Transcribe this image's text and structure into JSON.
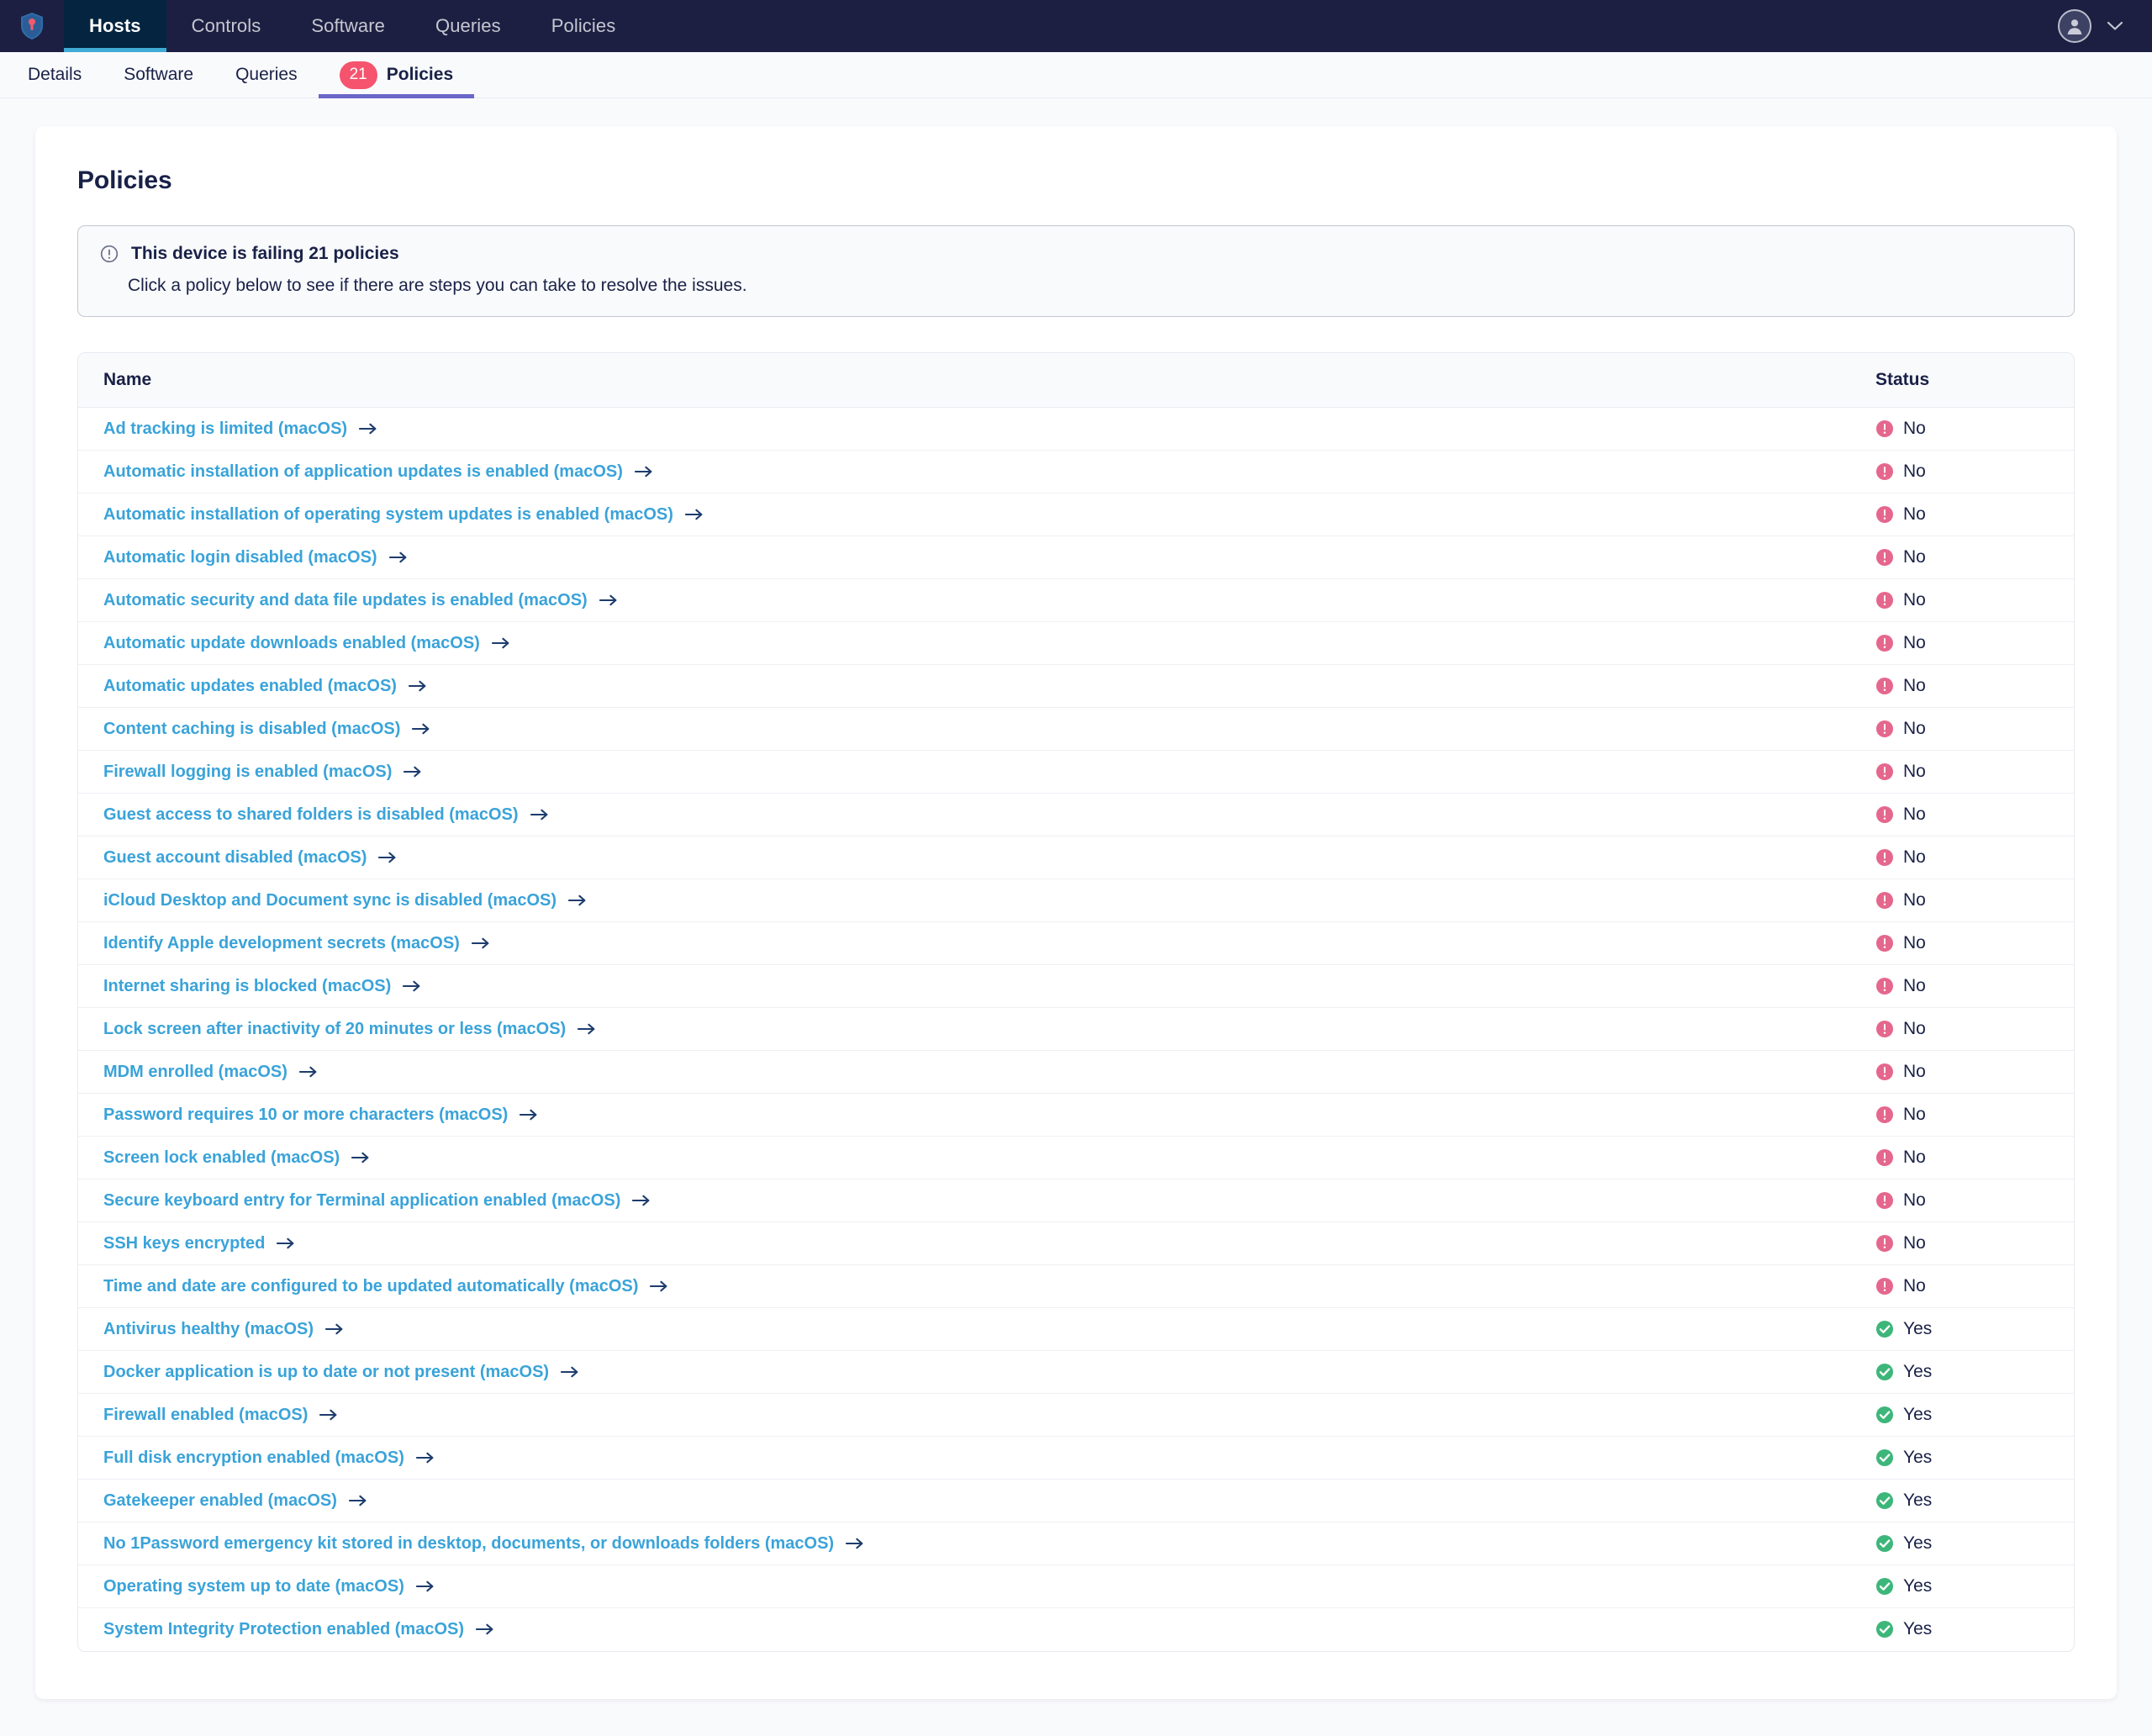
{
  "colors": {
    "nav_bg": "#1d1f42",
    "nav_active_bg": "#04243f",
    "nav_accent": "#3eabd5",
    "badge": "#f5536e",
    "subnav_active_underline": "#6a67c8",
    "link": "#3aa3d9",
    "arrow": "#1d3c6e",
    "fail": "#e5678e",
    "pass": "#3db67a",
    "text": "#192147",
    "page_bg": "#f9fafc"
  },
  "topnav": {
    "logo_icon": "shield-icon",
    "items": [
      {
        "label": "Hosts",
        "active": true
      },
      {
        "label": "Controls",
        "active": false
      },
      {
        "label": "Software",
        "active": false
      },
      {
        "label": "Queries",
        "active": false
      },
      {
        "label": "Policies",
        "active": false
      }
    ],
    "avatar_icon": "user-avatar-icon",
    "chevron_icon": "chevron-down-icon"
  },
  "subnav": {
    "items": [
      {
        "label": "Details",
        "badge": null,
        "active": false
      },
      {
        "label": "Software",
        "badge": null,
        "active": false
      },
      {
        "label": "Queries",
        "badge": null,
        "active": false
      },
      {
        "label": "Policies",
        "badge": "21",
        "active": true
      }
    ]
  },
  "main": {
    "title": "Policies",
    "banner": {
      "icon": "alert-circle-icon",
      "title": "This device is failing 21 policies",
      "subtitle": "Click a policy below to see if there are steps you can take to resolve the issues."
    },
    "table": {
      "columns": [
        "Name",
        "Status"
      ],
      "fail_icon": "exclamation-circle-icon",
      "pass_icon": "check-circle-icon",
      "arrow_icon": "arrow-right-icon",
      "rows": [
        {
          "name": "Ad tracking is limited (macOS)",
          "status": "No",
          "pass": false
        },
        {
          "name": "Automatic installation of application updates is enabled (macOS)",
          "status": "No",
          "pass": false
        },
        {
          "name": "Automatic installation of operating system updates is enabled (macOS)",
          "status": "No",
          "pass": false
        },
        {
          "name": "Automatic login disabled (macOS)",
          "status": "No",
          "pass": false
        },
        {
          "name": "Automatic security and data file updates is enabled (macOS)",
          "status": "No",
          "pass": false
        },
        {
          "name": "Automatic update downloads enabled (macOS)",
          "status": "No",
          "pass": false
        },
        {
          "name": "Automatic updates enabled (macOS)",
          "status": "No",
          "pass": false
        },
        {
          "name": "Content caching is disabled (macOS)",
          "status": "No",
          "pass": false
        },
        {
          "name": "Firewall logging is enabled (macOS)",
          "status": "No",
          "pass": false
        },
        {
          "name": "Guest access to shared folders is disabled (macOS)",
          "status": "No",
          "pass": false
        },
        {
          "name": "Guest account disabled (macOS)",
          "status": "No",
          "pass": false
        },
        {
          "name": "iCloud Desktop and Document sync is disabled (macOS)",
          "status": "No",
          "pass": false
        },
        {
          "name": "Identify Apple development secrets (macOS)",
          "status": "No",
          "pass": false
        },
        {
          "name": "Internet sharing is blocked (macOS)",
          "status": "No",
          "pass": false
        },
        {
          "name": "Lock screen after inactivity of 20 minutes or less (macOS)",
          "status": "No",
          "pass": false
        },
        {
          "name": "MDM enrolled (macOS)",
          "status": "No",
          "pass": false
        },
        {
          "name": "Password requires 10 or more characters (macOS)",
          "status": "No",
          "pass": false
        },
        {
          "name": "Screen lock enabled (macOS)",
          "status": "No",
          "pass": false
        },
        {
          "name": "Secure keyboard entry for Terminal application enabled (macOS)",
          "status": "No",
          "pass": false
        },
        {
          "name": "SSH keys encrypted",
          "status": "No",
          "pass": false
        },
        {
          "name": "Time and date are configured to be updated automatically (macOS)",
          "status": "No",
          "pass": false
        },
        {
          "name": "Antivirus healthy (macOS)",
          "status": "Yes",
          "pass": true
        },
        {
          "name": "Docker application is up to date or not present (macOS)",
          "status": "Yes",
          "pass": true
        },
        {
          "name": "Firewall enabled (macOS)",
          "status": "Yes",
          "pass": true
        },
        {
          "name": "Full disk encryption enabled (macOS)",
          "status": "Yes",
          "pass": true
        },
        {
          "name": "Gatekeeper enabled (macOS)",
          "status": "Yes",
          "pass": true
        },
        {
          "name": "No 1Password emergency kit stored in desktop, documents, or downloads folders (macOS)",
          "status": "Yes",
          "pass": true
        },
        {
          "name": "Operating system up to date (macOS)",
          "status": "Yes",
          "pass": true
        },
        {
          "name": "System Integrity Protection enabled (macOS)",
          "status": "Yes",
          "pass": true
        }
      ]
    }
  }
}
